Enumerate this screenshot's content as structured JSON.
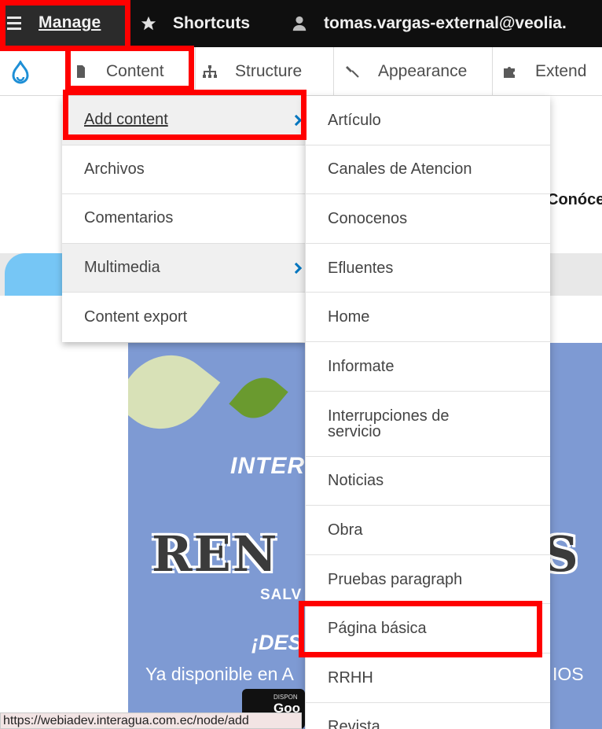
{
  "toolbar": {
    "manage_label": "Manage",
    "shortcuts_label": "Shortcuts",
    "user_label": "tomas.vargas-external@veolia."
  },
  "tray": {
    "content_label": "Content",
    "structure_label": "Structure",
    "appearance_label": "Appearance",
    "extend_label": "Extend"
  },
  "content_menu": [
    {
      "label": "Add content",
      "has_submenu": true,
      "active": true
    },
    {
      "label": "Archivos",
      "has_submenu": false
    },
    {
      "label": "Comentarios",
      "has_submenu": false
    },
    {
      "label": "Multimedia",
      "has_submenu": true
    },
    {
      "label": "Content export",
      "has_submenu": false
    }
  ],
  "add_content_menu": [
    "Artículo",
    "Canales de Atencion",
    "Conocenos",
    "Efluentes",
    "Home",
    "Informate",
    "Interrupciones de servicio",
    "Noticias",
    "Obra",
    "Pruebas paragraph",
    "Página básica",
    "RRHH",
    "Revista"
  ],
  "background": {
    "heading_fragment": "Conóce",
    "banner": {
      "inter": "INTER",
      "reno": "REN",
      "s": "S",
      "salv": "SALV",
      "des": "¡DES",
      "disponible": "Ya disponible en A",
      "ios": "IOS",
      "store_small": "DISPON",
      "store_big": "Goo"
    }
  },
  "status_url": "https://webiadev.interagua.com.ec/node/add",
  "colors": {
    "toolbar_bg": "#0f0f0f",
    "manage_bg": "#2b2b2b",
    "highlight": "#ff0000",
    "chevron": "#0076c0",
    "banner_bg": "#7e9ad3"
  }
}
